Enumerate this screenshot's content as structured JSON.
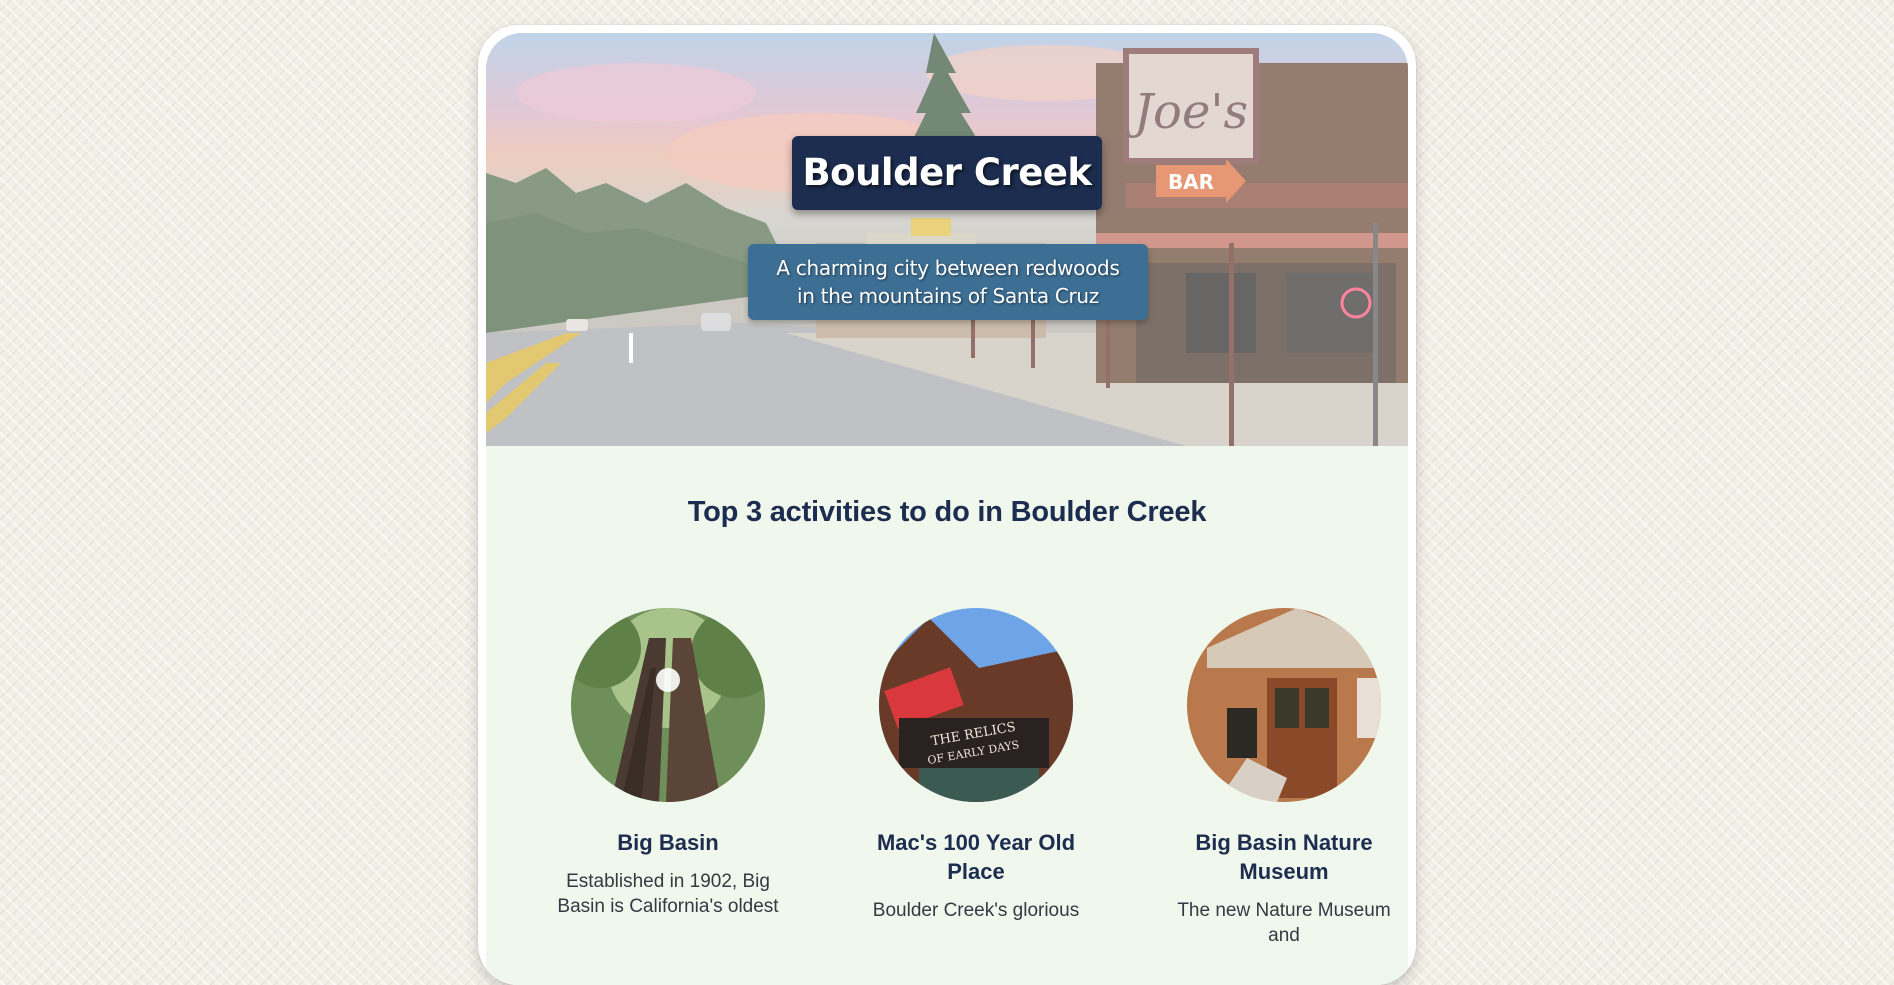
{
  "hero": {
    "title": "Boulder Creek",
    "subtitle_line1": "A charming city between redwoods",
    "subtitle_line2": "in the mountains of Santa Cruz",
    "sign_joes": "Joe's",
    "sign_bar": "BAR"
  },
  "activities_section": {
    "heading": "Top 3 activities to do in Boulder Creek",
    "items": [
      {
        "name": "Big Basin",
        "description": "Established in 1902, Big Basin is California's oldest"
      },
      {
        "name": "Mac's 100 Year Old Place",
        "description": "Boulder Creek's glorious",
        "sign_text_1": "THE RELICS",
        "sign_text_2": "OF EARLY DAYS"
      },
      {
        "name": "Big Basin Nature Museum",
        "description": "The new Nature Museum and"
      }
    ]
  },
  "colors": {
    "navy": "#1c2d4f",
    "steel_blue": "#3d6e93",
    "card_bg": "#f0f7ec",
    "page_bg": "#f1efe6"
  }
}
